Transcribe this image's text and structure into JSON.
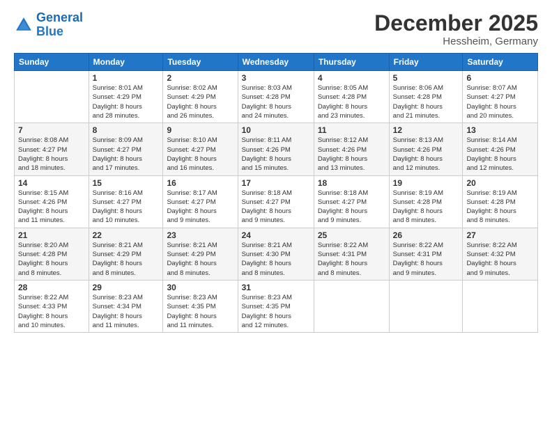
{
  "logo": {
    "line1": "General",
    "line2": "Blue"
  },
  "title": "December 2025",
  "subtitle": "Hessheim, Germany",
  "weekdays": [
    "Sunday",
    "Monday",
    "Tuesday",
    "Wednesday",
    "Thursday",
    "Friday",
    "Saturday"
  ],
  "weeks": [
    [
      {
        "day": "",
        "info": ""
      },
      {
        "day": "1",
        "info": "Sunrise: 8:01 AM\nSunset: 4:29 PM\nDaylight: 8 hours\nand 28 minutes."
      },
      {
        "day": "2",
        "info": "Sunrise: 8:02 AM\nSunset: 4:29 PM\nDaylight: 8 hours\nand 26 minutes."
      },
      {
        "day": "3",
        "info": "Sunrise: 8:03 AM\nSunset: 4:28 PM\nDaylight: 8 hours\nand 24 minutes."
      },
      {
        "day": "4",
        "info": "Sunrise: 8:05 AM\nSunset: 4:28 PM\nDaylight: 8 hours\nand 23 minutes."
      },
      {
        "day": "5",
        "info": "Sunrise: 8:06 AM\nSunset: 4:28 PM\nDaylight: 8 hours\nand 21 minutes."
      },
      {
        "day": "6",
        "info": "Sunrise: 8:07 AM\nSunset: 4:27 PM\nDaylight: 8 hours\nand 20 minutes."
      }
    ],
    [
      {
        "day": "7",
        "info": "Sunrise: 8:08 AM\nSunset: 4:27 PM\nDaylight: 8 hours\nand 18 minutes."
      },
      {
        "day": "8",
        "info": "Sunrise: 8:09 AM\nSunset: 4:27 PM\nDaylight: 8 hours\nand 17 minutes."
      },
      {
        "day": "9",
        "info": "Sunrise: 8:10 AM\nSunset: 4:27 PM\nDaylight: 8 hours\nand 16 minutes."
      },
      {
        "day": "10",
        "info": "Sunrise: 8:11 AM\nSunset: 4:26 PM\nDaylight: 8 hours\nand 15 minutes."
      },
      {
        "day": "11",
        "info": "Sunrise: 8:12 AM\nSunset: 4:26 PM\nDaylight: 8 hours\nand 13 minutes."
      },
      {
        "day": "12",
        "info": "Sunrise: 8:13 AM\nSunset: 4:26 PM\nDaylight: 8 hours\nand 12 minutes."
      },
      {
        "day": "13",
        "info": "Sunrise: 8:14 AM\nSunset: 4:26 PM\nDaylight: 8 hours\nand 12 minutes."
      }
    ],
    [
      {
        "day": "14",
        "info": "Sunrise: 8:15 AM\nSunset: 4:26 PM\nDaylight: 8 hours\nand 11 minutes."
      },
      {
        "day": "15",
        "info": "Sunrise: 8:16 AM\nSunset: 4:27 PM\nDaylight: 8 hours\nand 10 minutes."
      },
      {
        "day": "16",
        "info": "Sunrise: 8:17 AM\nSunset: 4:27 PM\nDaylight: 8 hours\nand 9 minutes."
      },
      {
        "day": "17",
        "info": "Sunrise: 8:18 AM\nSunset: 4:27 PM\nDaylight: 8 hours\nand 9 minutes."
      },
      {
        "day": "18",
        "info": "Sunrise: 8:18 AM\nSunset: 4:27 PM\nDaylight: 8 hours\nand 9 minutes."
      },
      {
        "day": "19",
        "info": "Sunrise: 8:19 AM\nSunset: 4:28 PM\nDaylight: 8 hours\nand 8 minutes."
      },
      {
        "day": "20",
        "info": "Sunrise: 8:19 AM\nSunset: 4:28 PM\nDaylight: 8 hours\nand 8 minutes."
      }
    ],
    [
      {
        "day": "21",
        "info": "Sunrise: 8:20 AM\nSunset: 4:28 PM\nDaylight: 8 hours\nand 8 minutes."
      },
      {
        "day": "22",
        "info": "Sunrise: 8:21 AM\nSunset: 4:29 PM\nDaylight: 8 hours\nand 8 minutes."
      },
      {
        "day": "23",
        "info": "Sunrise: 8:21 AM\nSunset: 4:29 PM\nDaylight: 8 hours\nand 8 minutes."
      },
      {
        "day": "24",
        "info": "Sunrise: 8:21 AM\nSunset: 4:30 PM\nDaylight: 8 hours\nand 8 minutes."
      },
      {
        "day": "25",
        "info": "Sunrise: 8:22 AM\nSunset: 4:31 PM\nDaylight: 8 hours\nand 8 minutes."
      },
      {
        "day": "26",
        "info": "Sunrise: 8:22 AM\nSunset: 4:31 PM\nDaylight: 8 hours\nand 9 minutes."
      },
      {
        "day": "27",
        "info": "Sunrise: 8:22 AM\nSunset: 4:32 PM\nDaylight: 8 hours\nand 9 minutes."
      }
    ],
    [
      {
        "day": "28",
        "info": "Sunrise: 8:22 AM\nSunset: 4:33 PM\nDaylight: 8 hours\nand 10 minutes."
      },
      {
        "day": "29",
        "info": "Sunrise: 8:23 AM\nSunset: 4:34 PM\nDaylight: 8 hours\nand 11 minutes."
      },
      {
        "day": "30",
        "info": "Sunrise: 8:23 AM\nSunset: 4:35 PM\nDaylight: 8 hours\nand 11 minutes."
      },
      {
        "day": "31",
        "info": "Sunrise: 8:23 AM\nSunset: 4:35 PM\nDaylight: 8 hours\nand 12 minutes."
      },
      {
        "day": "",
        "info": ""
      },
      {
        "day": "",
        "info": ""
      },
      {
        "day": "",
        "info": ""
      }
    ]
  ]
}
